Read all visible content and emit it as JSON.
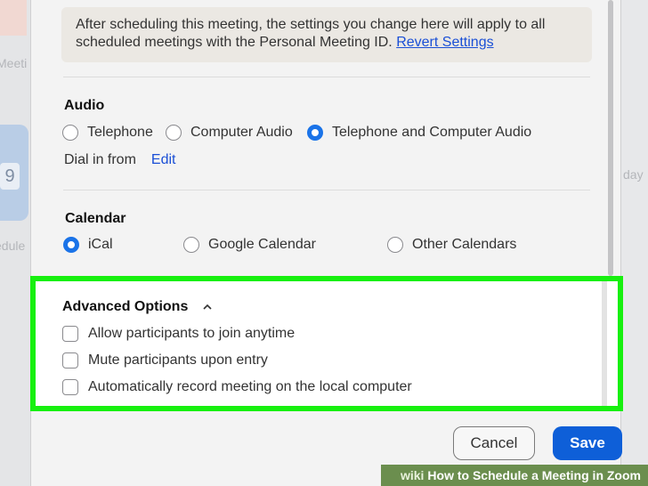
{
  "background": {
    "left_label_1": "Meeti",
    "left_label_2": "edule",
    "day_number": "9",
    "right_label": "day"
  },
  "notice": {
    "text": "After scheduling this meeting, the settings you change here will apply to all scheduled meetings with the Personal Meeting ID.",
    "link": "Revert Settings"
  },
  "audio": {
    "title": "Audio",
    "options": [
      "Telephone",
      "Computer Audio",
      "Telephone and Computer Audio"
    ],
    "selected": "Telephone and Computer Audio",
    "dial_in_label": "Dial in from",
    "edit_label": "Edit"
  },
  "calendar": {
    "title": "Calendar",
    "options": [
      "iCal",
      "Google Calendar",
      "Other Calendars"
    ],
    "selected": "iCal"
  },
  "advanced": {
    "title": "Advanced Options",
    "highlight_color": "#17f00f",
    "options": [
      {
        "label": "Allow participants to join anytime",
        "checked": false
      },
      {
        "label": "Mute participants upon entry",
        "checked": false
      },
      {
        "label": "Automatically record meeting on the local computer",
        "checked": false
      }
    ]
  },
  "buttons": {
    "cancel": "Cancel",
    "save": "Save"
  },
  "accent_color": "#0e5fd8",
  "watermark": {
    "prefix": "wiki",
    "text": "How to Schedule a Meeting in Zoom"
  }
}
